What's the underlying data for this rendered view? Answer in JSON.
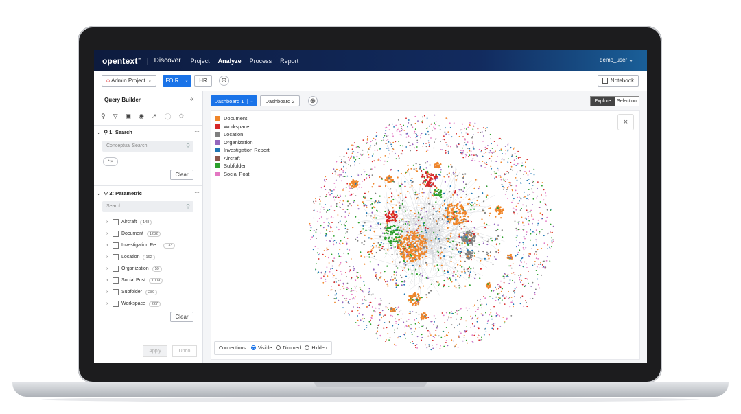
{
  "header": {
    "brand": "opentext",
    "brand_tm": "™",
    "separator": "|",
    "product": "Discover",
    "nav": [
      {
        "label": "Project",
        "active": false
      },
      {
        "label": "Analyze",
        "active": true
      },
      {
        "label": "Process",
        "active": false
      },
      {
        "label": "Report",
        "active": false
      }
    ],
    "user": "demo_user ⌄"
  },
  "toolbar": {
    "project_label": "Admin Project",
    "foir_label": "FOIR",
    "hr_label": "HR",
    "add_symbol": "⊕",
    "notebook_label": "Notebook"
  },
  "sidebar": {
    "title": "Query Builder",
    "collapse": "«",
    "search_section": "1: Search",
    "conceptual_placeholder": "Conceptual Search",
    "chip": "* ×",
    "clear_label": "Clear",
    "parametric_section": "2: Parametric",
    "param_search_placeholder": "Search",
    "param_items": [
      {
        "label": "Aircraft",
        "count": "148"
      },
      {
        "label": "Document",
        "count": "1232"
      },
      {
        "label": "Investigation Re...",
        "count": "133"
      },
      {
        "label": "Location",
        "count": "162"
      },
      {
        "label": "Organization",
        "count": "59"
      },
      {
        "label": "Social Post",
        "count": "1009"
      },
      {
        "label": "Subfolder",
        "count": "289"
      },
      {
        "label": "Workspace",
        "count": "227"
      }
    ],
    "apply_label": "Apply",
    "undo_label": "Undo",
    "more": "···"
  },
  "dashboard": {
    "tabs": [
      {
        "label": "Dashboard 1",
        "active": true
      },
      {
        "label": "Dashboard 2",
        "active": false
      }
    ],
    "mode_on": "Explore",
    "mode_off": "Selection",
    "legend": [
      {
        "label": "Document",
        "color": "#f0862a"
      },
      {
        "label": "Workspace",
        "color": "#d62728"
      },
      {
        "label": "Location",
        "color": "#7f7f7f"
      },
      {
        "label": "Organization",
        "color": "#9467bd"
      },
      {
        "label": "Investigation Report",
        "color": "#1f77b4"
      },
      {
        "label": "Aircraft",
        "color": "#8c564b"
      },
      {
        "label": "Subfolder",
        "color": "#2ca02c"
      },
      {
        "label": "Social Post",
        "color": "#e377c2"
      }
    ],
    "close": "×",
    "connections_label": "Connections:",
    "connection_options": [
      {
        "label": "Visible",
        "checked": true
      },
      {
        "label": "Dimmed",
        "checked": false
      },
      {
        "label": "Hidden",
        "checked": false
      }
    ]
  }
}
